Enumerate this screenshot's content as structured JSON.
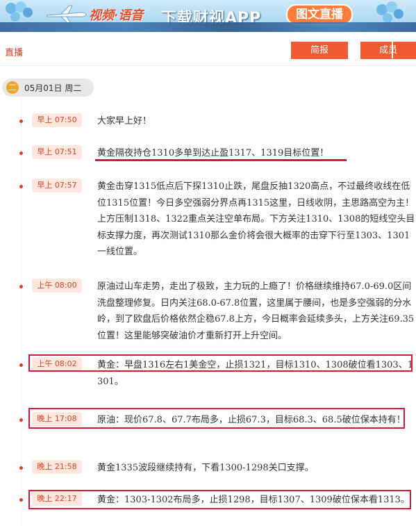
{
  "banner": {
    "slogan": "视频·语音",
    "headline": "下载财视APP",
    "badge": "图文直播"
  },
  "header": {
    "title": "直播",
    "brief_label": "简报",
    "member_label": "成员"
  },
  "date": {
    "icon_glyph": "二",
    "label": "05月01日 周二"
  },
  "items": [
    {
      "time": "早上 07:50",
      "text": "大家早上好！"
    },
    {
      "time": "早上 07:51",
      "text": "黄金隔夜持仓1310多单到达止盈1317、1319目标位置！"
    },
    {
      "time": "早上 07:57",
      "text": "黄金击穿1315低点后下探1310止跌，尾盘反抽1320高点，不过最终收线在低位1315位置！今日多空强弱分界点再1315这里，日线收阴，主思路高空为主！上方压制1318、1322重点关注空单布局。下方关注1310、1308的短线空头目标支撑力度，再次测试1310那么金价将会很大概率的击穿下行至1303、1301一线位置。"
    },
    {
      "time": "上午 08:00",
      "text": "原油过山车走势，走出了极致，主力玩的上瘾了！价格继续维持67.0-69.0区间洗盘整理修复。日内关注68.0-67.8位置，这里属于腰间，也是多空强弱的分水岭，到了欧盘后价格依然企稳67.8上方，今日概率会延续多头，上方关注69.35位置！这里能够突破油价才重新打开上升空间。"
    },
    {
      "time": "上午 08:02",
      "text": "黄金：早盘1316左右1美金空，止损1321，目标1310、1308破位看1303、1301。"
    },
    {
      "time": "晚上 17:08",
      "text": "原油：现价67.8、67.7布局多，止损67.3，目标68.3、68.5破位保本持有！"
    },
    {
      "time": "晚上 21:58",
      "text": "黄金1335波段继续持有，下看1300-1298关口支撑。"
    },
    {
      "time": "晚上 22:17",
      "text": "黄金：1303-1302布局多，止损1298，目标1307、1309破位保本看1313。"
    }
  ],
  "colors": {
    "accent": "#f05a32",
    "highlight": "#d9192f",
    "time_badge_bg": "#fde7df"
  }
}
